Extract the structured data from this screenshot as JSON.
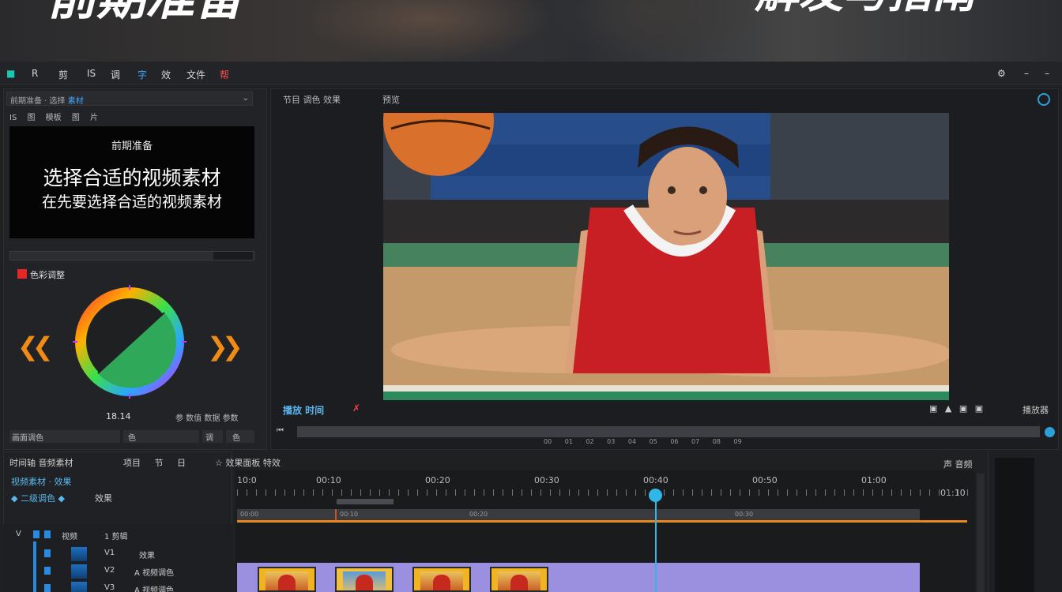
{
  "banner": {
    "title_left": "前期准备",
    "title_right": "解发与指南"
  },
  "menu": {
    "items": [
      "R",
      "剪",
      "IS",
      "调",
      "字",
      "效",
      "文件",
      "帮"
    ]
  },
  "left_panel": {
    "header": "前期准备 · 选择",
    "header_highlight": "素材",
    "tabs": "IS 图 模板 图 片",
    "preview_small": "前期准备",
    "preview_big": "选择合适的视频素材",
    "preview_sub": "在先要选择合适的视频素材",
    "color_label": "色彩调整",
    "wheel_value": "18.14",
    "wheel_right_label": "参 数值 数据 参数",
    "field1": "画面调色",
    "field2": "色",
    "field3": "调",
    "field4": "色"
  },
  "monitor": {
    "tab1": "节目 调色 效果",
    "tab2": "预览",
    "timecode": "播放 时间",
    "timecode_red": "✗",
    "controls": "▣ ▲ ▣ ▣",
    "controls_label": "播放器",
    "scrub_left": "⏮",
    "tick_labels": "00 01 02 03 04 05 06 07 08 09"
  },
  "project_panel": {
    "tabs": "时间轴 音频素材",
    "row1": "视频素材 · 效果",
    "row2a": "◆ 二级调色 ◆",
    "row2b": "效果"
  },
  "timeline_tabs": {
    "tabs": "项目 节 日",
    "active": "☆ 效果面板 特效",
    "right_label": "声 音频"
  },
  "tracks": [
    {
      "name": "V",
      "label": "视频",
      "sub": "1 剪辑"
    },
    {
      "name": "",
      "label": "V1",
      "sub": "效果"
    },
    {
      "name": "",
      "label": "V2",
      "sub": "A 视频调色"
    },
    {
      "name": "",
      "label": "V3",
      "sub": "A 视频调色"
    }
  ],
  "ruler": {
    "start": "10:0",
    "labels": [
      "00:10",
      "00:20",
      "00:30",
      "00:40",
      "00:50",
      "01:00",
      "01:10"
    ]
  },
  "work_area_labels": [
    "00:00",
    "00:10",
    "00:20",
    "00:30"
  ],
  "colors": {
    "accent_blue": "#2fb7e8",
    "accent_orange": "#e8891e",
    "clip_purple": "#9b8fe0",
    "clip_yellow": "#f0b422"
  }
}
